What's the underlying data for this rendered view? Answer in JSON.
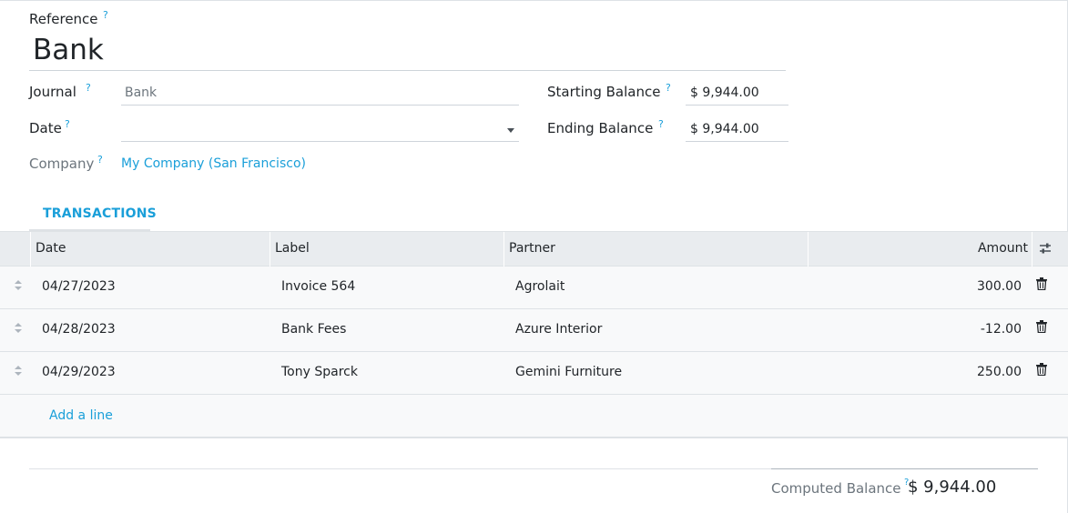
{
  "form": {
    "reference_label": "Reference",
    "reference_value": "Bank",
    "help_mark": "?",
    "journal_label": "Journal",
    "journal_placeholder": "Bank",
    "date_label": "Date",
    "date_value": "",
    "company_label": "Company",
    "company_value": "My Company (San Francisco)",
    "starting_balance_label": "Starting Balance",
    "starting_balance_value": "$ 9,944.00",
    "ending_balance_label": "Ending Balance",
    "ending_balance_value": "$ 9,944.00"
  },
  "tabs": [
    {
      "label": "TRANSACTIONS",
      "active": true
    }
  ],
  "table": {
    "columns": [
      "Date",
      "Label",
      "Partner",
      "Amount"
    ],
    "rows": [
      {
        "date": "04/27/2023",
        "label": "Invoice 564",
        "partner": "Agrolait",
        "amount": "300.00"
      },
      {
        "date": "04/28/2023",
        "label": "Bank Fees",
        "partner": "Azure Interior",
        "amount": "-12.00"
      },
      {
        "date": "04/29/2023",
        "label": "Tony Sparck",
        "partner": "Gemini Furniture",
        "amount": "250.00"
      }
    ],
    "add_line_label": "Add a line"
  },
  "footer": {
    "computed_balance_label": "Computed Balance",
    "computed_balance_value": "$ 9,944.00"
  },
  "icons": {
    "row_handle": "drag-handle-icon",
    "row_delete": "trash-icon",
    "column_settings": "adjust-columns-icon",
    "date_dropdown": "caret-down-icon"
  },
  "colors": {
    "accent": "#1a9fd9",
    "header_bg": "#e9ecef",
    "row_bg": "#f8f9fa",
    "muted_text": "#6c757d"
  }
}
